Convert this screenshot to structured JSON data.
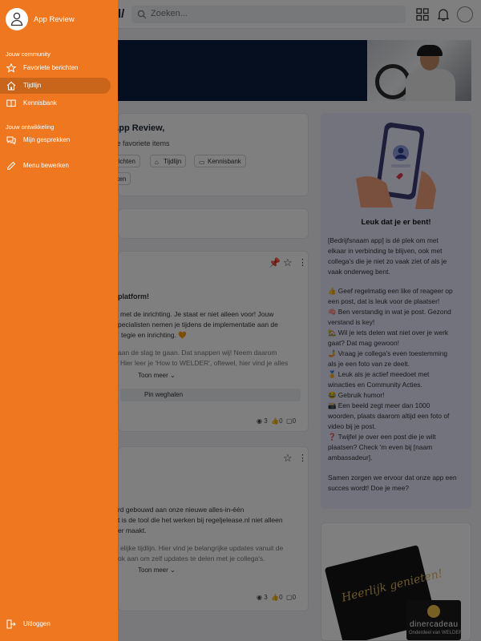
{
  "drawer": {
    "app_name": "App Review",
    "section_community": "Jouw community",
    "section_development": "Jouw ontwikkeling",
    "items": [
      {
        "label": "Favoriete berichten",
        "icon": "star-icon"
      },
      {
        "label": "Tijdlijn",
        "icon": "home-icon",
        "active": true
      },
      {
        "label": "Kennisbank",
        "icon": "book-icon"
      },
      {
        "label": "Mijn gesprekken",
        "icon": "chat-icon"
      },
      {
        "label": "Menu bewerken",
        "icon": "pencil-icon"
      }
    ],
    "logout": "Uitloggen",
    "color": "#ee771f"
  },
  "topbar": {
    "brand_tail": "l/",
    "search_placeholder": "Zoeken..."
  },
  "welcome": {
    "title": "g App Review,",
    "subtitle": "tot je favoriete items",
    "chips": [
      "berichten",
      "Tijdlijn",
      "Kennisbank",
      "ekken"
    ]
  },
  "post1": {
    "title": "platform!",
    "lines": [
      "met de inrichting. Je staat er niet alleen voor! Jouw",
      "pecialisten nemen je tijdens de implementatie aan de",
      "tegie en inrichting. 🧡"
    ],
    "faded_lines": [
      "aan de slag te gaan. Dat snappen wij! Neem daarom",
      "Hier leer je 'How to WELDER', oftewel, hier vind je alles"
    ],
    "show_more": "Toon meer",
    "unpin": "Pin weghalen",
    "views": "3",
    "likes": "0",
    "comments": "0"
  },
  "post2": {
    "lines": [
      "rd gebouwd aan onze nieuwe alles-in-één",
      "t is de tool die het werken bij regeljelease.nl niet alleen",
      "er maakt."
    ],
    "faded_lines": [
      "elijke tijdlijn. Hier vind je belangrijke updates vanuit de",
      "ok aan om zelf updates te delen met je collega's."
    ],
    "show_more": "Toon meer",
    "views": "3",
    "likes": "0",
    "comments": "0"
  },
  "side": {
    "title": "Leuk dat je er bent!",
    "intro": [
      "[Bedrijfsnaam app] is dé plek om met",
      "elkaar in verbinding te blijven, ook met",
      "collega's die je niet zo vaak ziet of als je",
      "vaak onderweg bent."
    ],
    "tips": [
      {
        "emoji": "👍",
        "lines": [
          "Geef regelmatig een like of reageer op",
          "een post, dat is leuk voor de plaatser!"
        ]
      },
      {
        "emoji": "🧠",
        "lines": [
          "Ben verstandig in wat je post. Gezond",
          "verstand is key!"
        ]
      },
      {
        "emoji": "🏡",
        "lines": [
          "Wil je iets delen wat niet over je werk",
          "gaat? Dat mag gewoon!"
        ]
      },
      {
        "emoji": "🤳",
        "lines": [
          "Vraag je collega's even toestemming",
          "als je een foto van ze deelt."
        ]
      },
      {
        "emoji": "🏅",
        "lines": [
          "Leuk als je actief meedoet met",
          "winacties en Community Acties."
        ]
      },
      {
        "emoji": "😂",
        "lines": [
          "Gebruik humor!"
        ]
      },
      {
        "emoji": "📸",
        "lines": [
          "Een beeld zegt meer dan 1000",
          "woorden, plaats daarom altijd een foto of",
          "video bij je post."
        ]
      },
      {
        "emoji": "❓",
        "lines": [
          "Twijfel je over een post die je wilt",
          "plaatsen? Check 'm even bij [naam",
          "ambassadeur]."
        ]
      }
    ],
    "outro": [
      "Samen zorgen we ervoor dat onze app een",
      "succes wordt! Doe je mee?"
    ]
  },
  "promo": {
    "card_text": "Heerlijk genieten!",
    "brand": "dinercadeau",
    "brand_sub": "Onderdeel van WELDER"
  }
}
